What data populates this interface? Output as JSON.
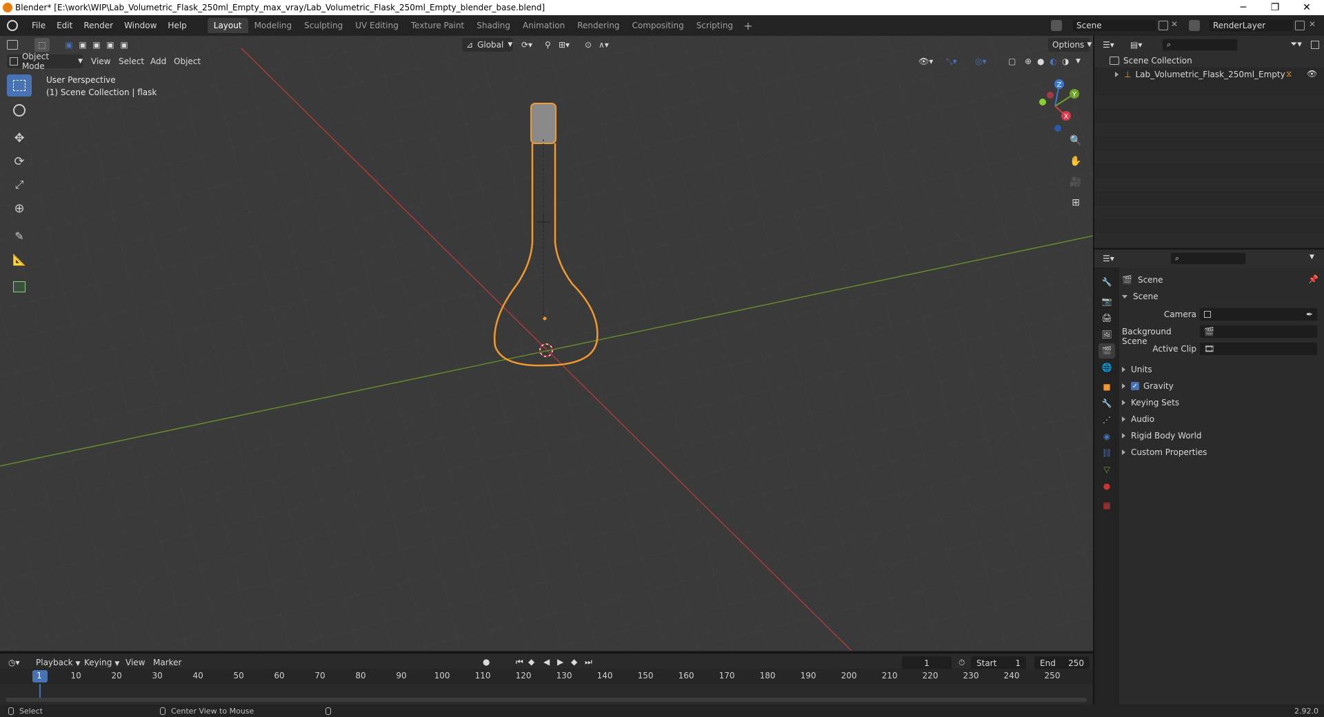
{
  "window": {
    "title": "Blender* [E:\\work\\WIP\\Lab_Volumetric_Flask_250ml_Empty_max_vray/Lab_Volumetric_Flask_250ml_Empty_blender_base.blend]",
    "controls": {
      "minimize": "─",
      "maximize": "❐",
      "close": "✕"
    }
  },
  "menu": [
    "File",
    "Edit",
    "Render",
    "Window",
    "Help"
  ],
  "workspaces": [
    "Layout",
    "Modeling",
    "Sculpting",
    "UV Editing",
    "Texture Paint",
    "Shading",
    "Animation",
    "Rendering",
    "Compositing",
    "Scripting"
  ],
  "active_workspace": "Layout",
  "scene_field": "Scene",
  "renderlayer_field": "RenderLayer",
  "viewport": {
    "mode": "Object Mode",
    "menus": [
      "View",
      "Select",
      "Add",
      "Object"
    ],
    "transform_orientation": "Global",
    "options_label": "Options",
    "perspective_label": "User Perspective",
    "collection_label": "(1) Scene Collection | flask",
    "gizmo_axes": {
      "x": "X",
      "y": "Y",
      "z": "Z"
    }
  },
  "outliner": {
    "root": "Scene Collection",
    "items": [
      {
        "label": "Lab_Volumetric_Flask_250ml_Empty"
      }
    ]
  },
  "properties": {
    "header": "Scene",
    "section": "Scene",
    "fields": [
      {
        "label": "Camera",
        "value": ""
      },
      {
        "label": "Background Scene",
        "value": ""
      },
      {
        "label": "Active Clip",
        "value": ""
      }
    ],
    "panels": [
      "Units",
      "Gravity",
      "Keying Sets",
      "Audio",
      "Rigid Body World",
      "Custom Properties"
    ],
    "gravity_checked": true
  },
  "timeline": {
    "menus": [
      "Playback",
      "Keying",
      "View",
      "Marker"
    ],
    "current_frame": "1",
    "start_label": "Start",
    "start": "1",
    "end_label": "End",
    "end": "250",
    "ticks": [
      "1",
      "10",
      "20",
      "30",
      "40",
      "50",
      "60",
      "70",
      "80",
      "90",
      "100",
      "110",
      "120",
      "130",
      "140",
      "150",
      "160",
      "170",
      "180",
      "190",
      "200",
      "210",
      "220",
      "230",
      "240",
      "250"
    ]
  },
  "statusbar": {
    "left": "Select",
    "middle": "Center View to Mouse",
    "version": "2.92.0"
  },
  "colors": {
    "accent": "#4772b3",
    "selection_orange": "#f29a2e",
    "x_axis": "#b03a3a",
    "y_axis": "#6a8f2a"
  }
}
